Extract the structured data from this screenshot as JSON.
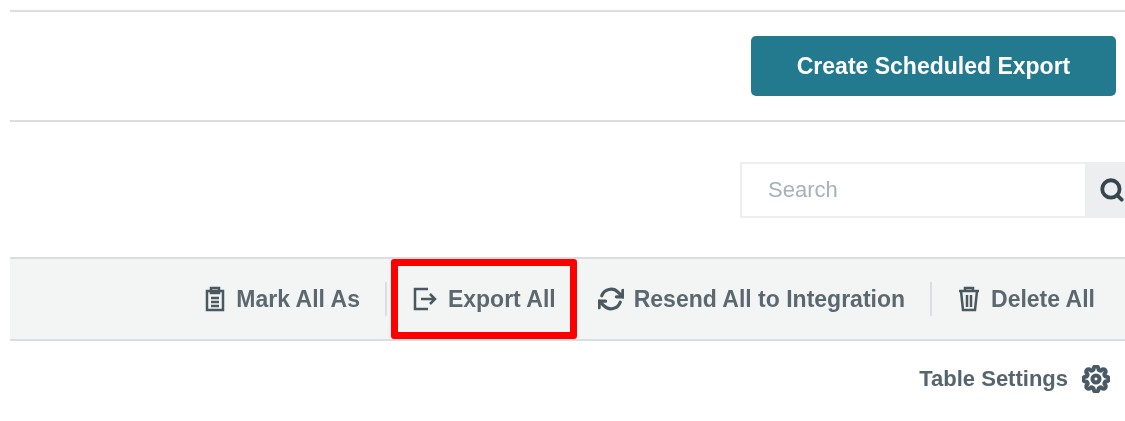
{
  "header": {
    "button": "Create Scheduled Export"
  },
  "search": {
    "placeholder": "Search"
  },
  "toolbar": {
    "actions": [
      {
        "kind": "mark",
        "label": "Mark All As",
        "highlighted": false,
        "divider_after": true
      },
      {
        "kind": "export",
        "label": "Export All",
        "highlighted": true,
        "divider_after": false
      },
      {
        "kind": "resend",
        "label": "Resend All to Integration",
        "highlighted": false,
        "divider_after": true
      },
      {
        "kind": "delete",
        "label": "Delete All",
        "highlighted": false,
        "divider_after": false
      }
    ]
  },
  "table_settings": {
    "label": "Table Settings"
  }
}
